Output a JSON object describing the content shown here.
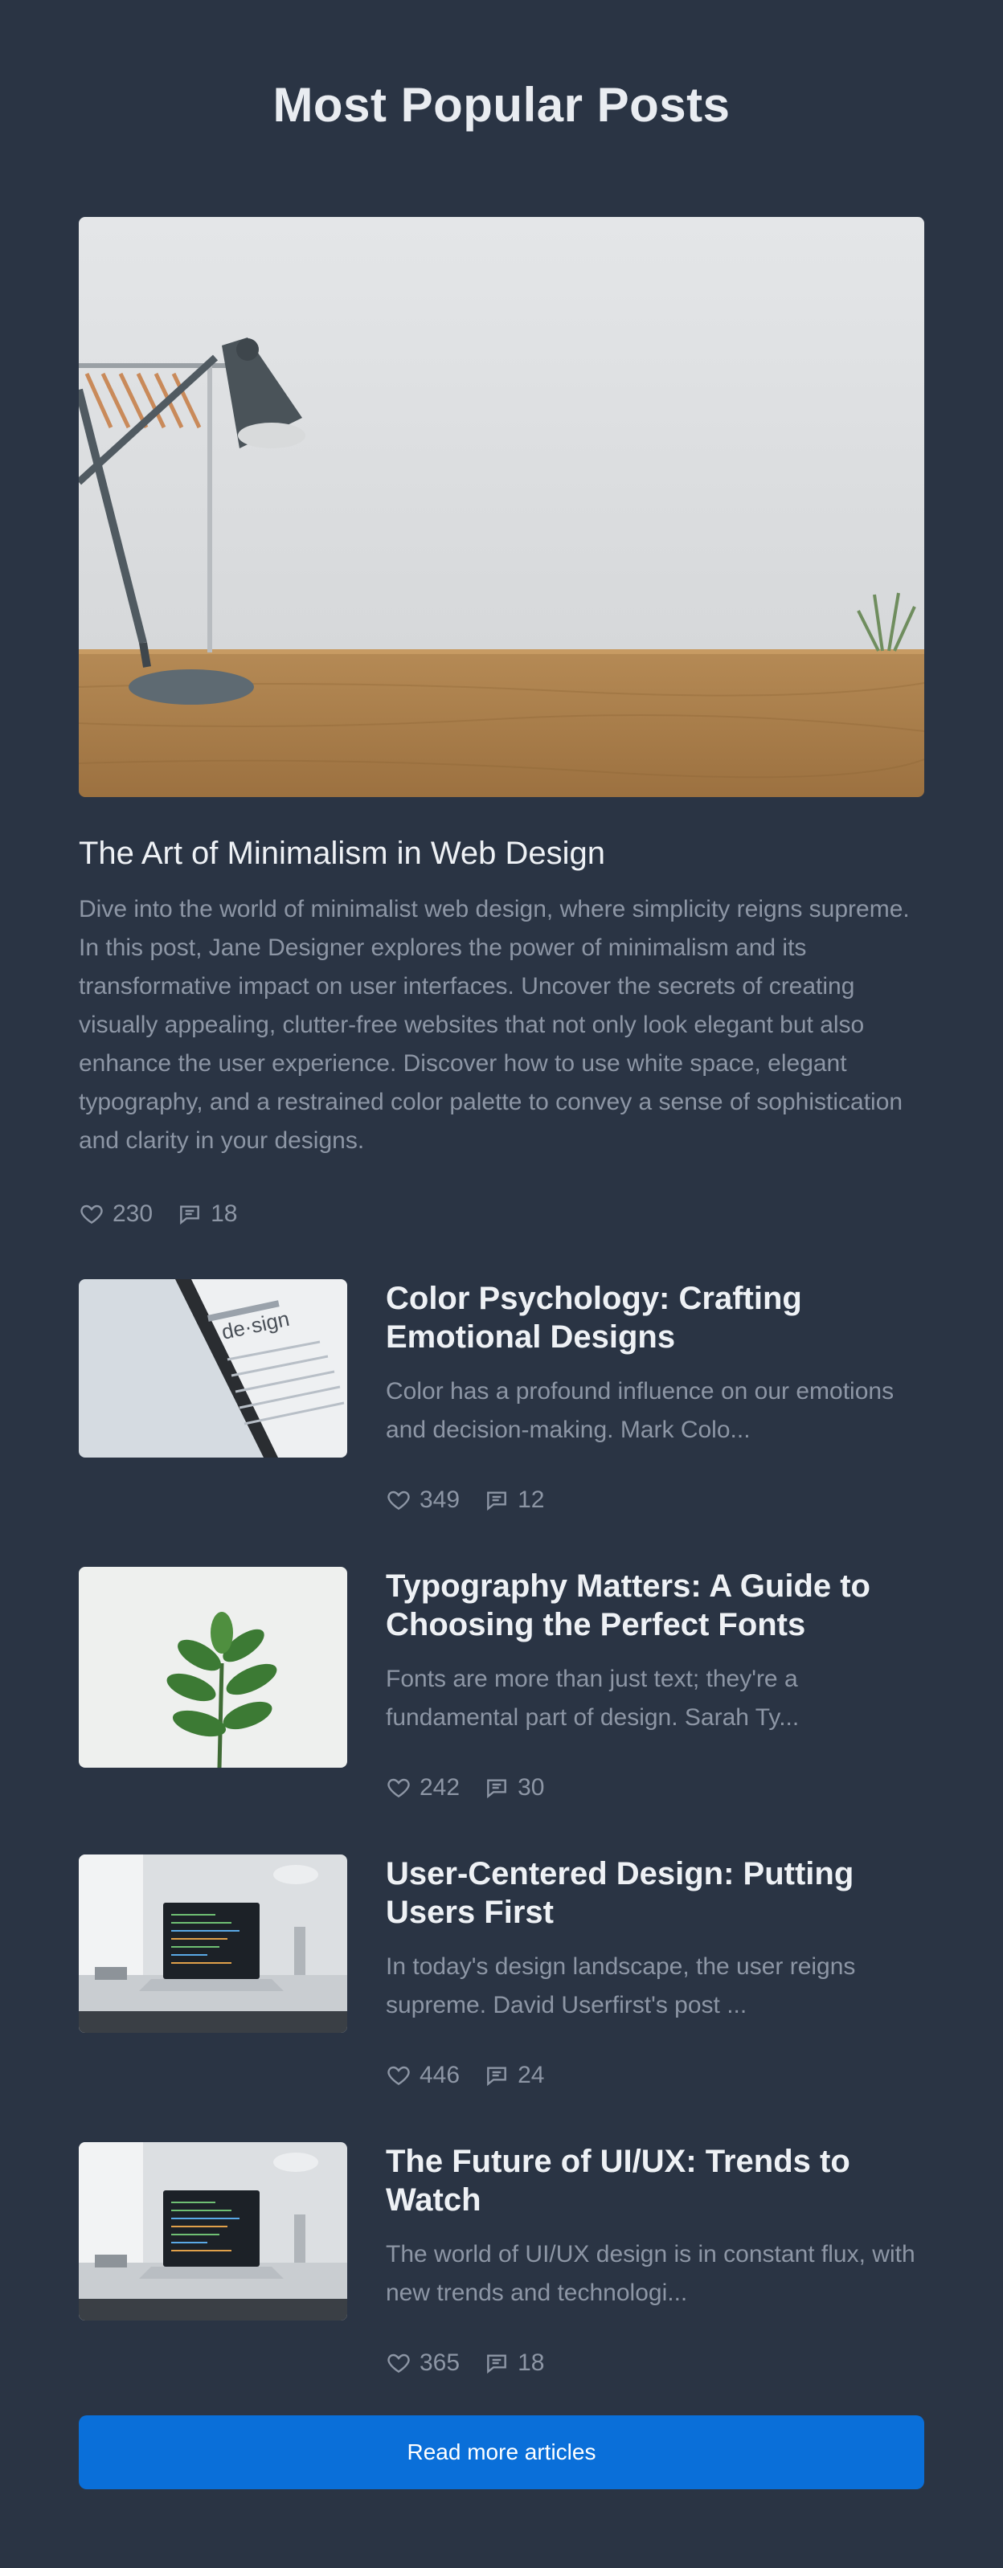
{
  "page": {
    "title": "Most Popular Posts"
  },
  "featured": {
    "title": "The Art of Minimalism in Web Design",
    "excerpt": "Dive into the world of minimalist web design, where simplicity reigns supreme. In this post, Jane Designer explores the power of minimalism and its transformative impact on user interfaces. Uncover the secrets of creating visually appealing, clutter-free websites that not only look elegant but also enhance the user experience. Discover how to use white space, elegant typography, and a restrained color palette to convey a sense of sophistication and clarity in your designs.",
    "likes": "230",
    "comments": "18",
    "image": "desk-lamp-photo"
  },
  "posts": [
    {
      "title": "Color Psychology: Crafting Emotional Designs",
      "excerpt": "Color has a profound influence on our emotions and decision-making. Mark Colo...",
      "likes": "349",
      "comments": "12",
      "image": "phone-dictionary-photo"
    },
    {
      "title": "Typography Matters: A Guide to Choosing the Perfect Fonts",
      "excerpt": "Fonts are more than just text; they're a fundamental part of design. Sarah Ty...",
      "likes": "242",
      "comments": "30",
      "image": "plant-photo"
    },
    {
      "title": "User-Centered Design: Putting Users First",
      "excerpt": "In today's design landscape, the user reigns supreme. David Userfirst's post ...",
      "likes": "446",
      "comments": "24",
      "image": "laptop-desk-photo"
    },
    {
      "title": "The Future of UI/UX: Trends to Watch",
      "excerpt": "The world of UI/UX design is in constant flux, with new trends and technologi...",
      "likes": "365",
      "comments": "18",
      "image": "laptop-desk-photo"
    }
  ],
  "cta": {
    "label": "Read more articles"
  },
  "icons": {
    "like": "heart-icon",
    "comment": "comment-icon"
  },
  "colors": {
    "background": "#2a3444",
    "accent": "#0a6fd9",
    "muted_text": "#8d96a5"
  }
}
